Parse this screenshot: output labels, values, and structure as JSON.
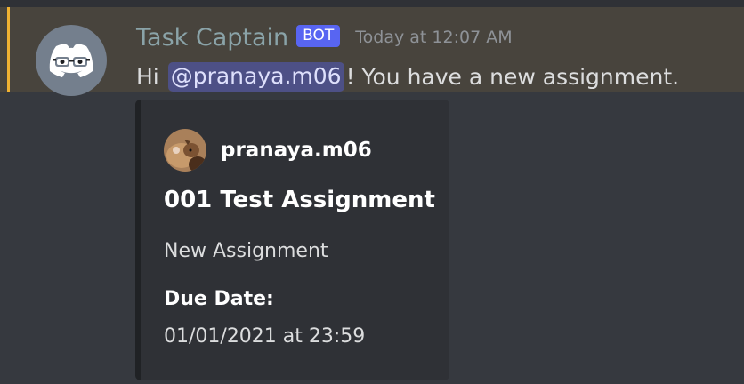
{
  "message": {
    "author": {
      "name": "Task Captain",
      "badge": "BOT",
      "avatar_icon": "discord-bot-avatar-icon"
    },
    "timestamp": "Today at 12:07 AM",
    "content": {
      "prefix": "Hi",
      "mention": "@pranaya.m06",
      "suffix": "! You have a new assignment."
    }
  },
  "embed": {
    "author": {
      "name": "pranaya.m06",
      "avatar_icon": "user-avatar-icon"
    },
    "title": "001 Test Assignment",
    "description": "New Assignment",
    "fields": [
      {
        "name": "Due Date:",
        "value": "01/01/2021 at 23:59"
      }
    ]
  },
  "colors": {
    "background": "#36393f",
    "highlight_row": "#48443d",
    "mention_stripe": "#f0b232",
    "bot_badge": "#5865f2",
    "embed_background": "#2f3136",
    "embed_stripe": "#202225",
    "mention_background": "#4d5086"
  }
}
